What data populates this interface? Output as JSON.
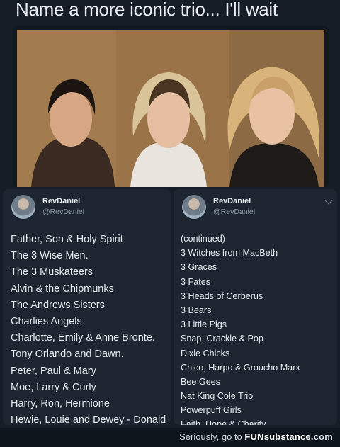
{
  "headline": "Name a more iconic trio... I'll wait",
  "left_tweet": {
    "name": "RevDaniel",
    "handle": "@RevDaniel",
    "lines": [
      "Father, Son & Holy Spirit",
      "The 3 Wise Men.",
      "The 3 Muskateers",
      "Alvin & the Chipmunks",
      "The Andrews Sisters",
      "Charlies Angels",
      "Charlotte, Emily & Anne Bronte.",
      "Tony Orlando and Dawn.",
      "Peter, Paul & Mary",
      "Moe, Larry & Curly",
      "Harry, Ron, Hermione",
      "Hewie, Louie and Dewey - Donald"
    ]
  },
  "right_tweet": {
    "name": "RevDaniel",
    "handle": "@RevDaniel",
    "lines": [
      "(continued)",
      "3 Witches from MacBeth",
      "3 Graces",
      "3 Fates",
      "3 Heads of Cerberus",
      "3 Bears",
      "3 Little Pigs",
      "Snap, Crackle & Pop",
      "Dixie Chicks",
      "Chico, Harpo & Groucho Marx",
      "Bee Gees",
      "Nat King Cole Trio",
      "Powerpuff Girls",
      "Faith, Hope & Charity"
    ]
  },
  "footer": {
    "prefix": "Seriously, go to",
    "brand_fun": "FUN",
    "brand_substance": "substance",
    "brand_com": ".com"
  }
}
